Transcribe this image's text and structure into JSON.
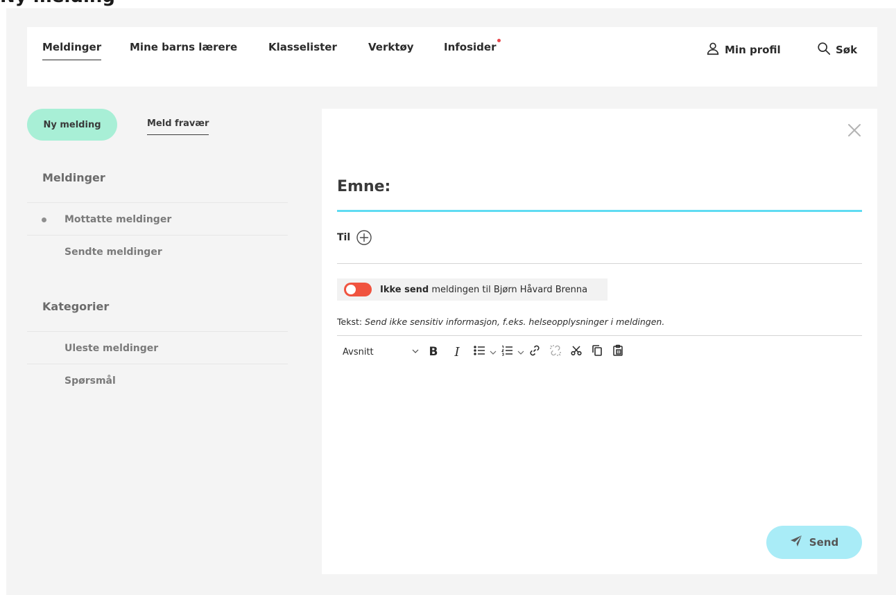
{
  "page": {
    "title_fragment": "Ny melding"
  },
  "nav": {
    "items": [
      {
        "label": "Meldinger",
        "active": true
      },
      {
        "label": "Mine barns lærere"
      },
      {
        "label": "Klasselister"
      },
      {
        "label": "Verktøy"
      },
      {
        "label": "Infosider",
        "has_notification": true
      }
    ],
    "profile_label": "Min profil",
    "search_label": "Søk",
    "notification_color": "#e8474c"
  },
  "sidebar": {
    "new_message_label": "Ny melding",
    "report_absence_label": "Meld fravær",
    "messages_heading": "Meldinger",
    "message_items": [
      {
        "label": "Mottatte meldinger",
        "selected": true
      },
      {
        "label": "Sendte meldinger"
      }
    ],
    "categories_heading": "Kategorier",
    "category_items": [
      {
        "label": "Uleste meldinger"
      },
      {
        "label": "Spørsmål"
      }
    ]
  },
  "compose": {
    "subject_label": "Emne:",
    "to_label": "Til",
    "toggle": {
      "on": false,
      "bold_text": "Ikke send",
      "text": " meldingen til Bjørn Håvard Brenna"
    },
    "text_hint_label": "Tekst: ",
    "text_hint": "Send ikke sensitiv informasjon, f.eks. helseopplysninger i meldingen.",
    "toolbar": {
      "block_format": "Avsnitt",
      "bold_label": "B",
      "italic_label": "I",
      "icons": [
        "bullet-list-icon",
        "numbered-list-icon",
        "link-icon",
        "unlink-icon",
        "cut-icon",
        "copy-icon",
        "paste-icon"
      ]
    },
    "body_value": "",
    "send_label": "Send"
  },
  "colors": {
    "accent_green": "#a8efd6",
    "accent_cyan": "#5fdcf2",
    "send_bg": "#a9ecf7",
    "toggle_off": "#f0533f"
  }
}
